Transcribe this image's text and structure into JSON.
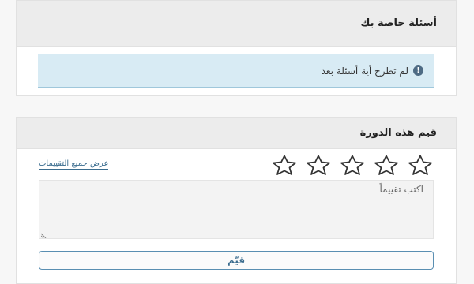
{
  "questions_panel": {
    "title": "أسئلة خاصة بك",
    "notice_text": "لم تطرح أية أسئلة بعد",
    "notice_icon": "exclamation-circle-icon"
  },
  "rating_panel": {
    "title": "قيم هذه الدورة",
    "star_count": 5,
    "star_icon": "star-outline-icon",
    "all_ratings_link": "عرض جميع التقييمات",
    "review_placeholder": "اكتب تقييماً",
    "rate_button": "قيّم"
  },
  "colors": {
    "header_bg": "#ececec",
    "notice_bg": "#d8ebf4",
    "link": "#3b6d8f",
    "button_border": "#5a8fb2"
  }
}
